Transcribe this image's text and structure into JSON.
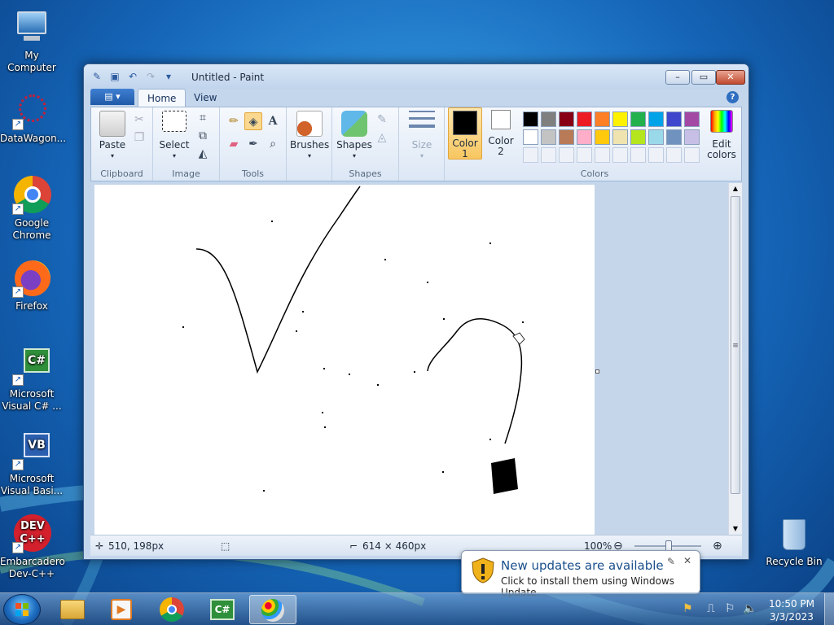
{
  "desktop": {
    "icons": [
      {
        "label": "My Computer"
      },
      {
        "label": "DataWagon..."
      },
      {
        "label": "Google Chrome"
      },
      {
        "label": "Firefox"
      },
      {
        "label": "Microsoft Visual C# ..."
      },
      {
        "label": "Microsoft Visual Basi..."
      },
      {
        "label": "Embarcadero Dev-C++"
      },
      {
        "label": "Recycle Bin"
      }
    ]
  },
  "window": {
    "title": "Untitled - Paint",
    "controls": {
      "minimize": "▭",
      "maximize": "▭",
      "close": "✕"
    }
  },
  "ribbon": {
    "file_tab": "▤ ▾",
    "tabs": [
      "Home",
      "View"
    ],
    "help": "?",
    "groups": {
      "clipboard": {
        "label": "Clipboard",
        "paste": "Paste"
      },
      "image": {
        "label": "Image",
        "select": "Select"
      },
      "tools": {
        "label": "Tools"
      },
      "brushes": {
        "label": "Brushes"
      },
      "shapes": {
        "label": "Shapes",
        "button": "Shapes"
      },
      "size": {
        "label": "Size"
      },
      "colors": {
        "label": "Colors",
        "color1": "Color 1",
        "color2": "Color 2",
        "edit": "Edit colors",
        "palette_row1": [
          "#000000",
          "#7f7f7f",
          "#880015",
          "#ed1c24",
          "#ff7f27",
          "#fff200",
          "#22b14c",
          "#00a2e8",
          "#3f48cc",
          "#a349a4"
        ],
        "palette_row2": [
          "#ffffff",
          "#c3c3c3",
          "#b97a57",
          "#ffaec9",
          "#ffc90e",
          "#efe4b0",
          "#b5e61d",
          "#99d9ea",
          "#7092be",
          "#c8bfe7"
        ]
      }
    }
  },
  "status": {
    "cursor_pos": "510, 198px",
    "canvas_size": "614 × 460px",
    "zoom": "100%"
  },
  "notification": {
    "title": "New updates are available",
    "body": "Click to install them using Windows Update."
  },
  "taskbar": {
    "time": "10:50 PM",
    "date": "3/3/2023"
  }
}
